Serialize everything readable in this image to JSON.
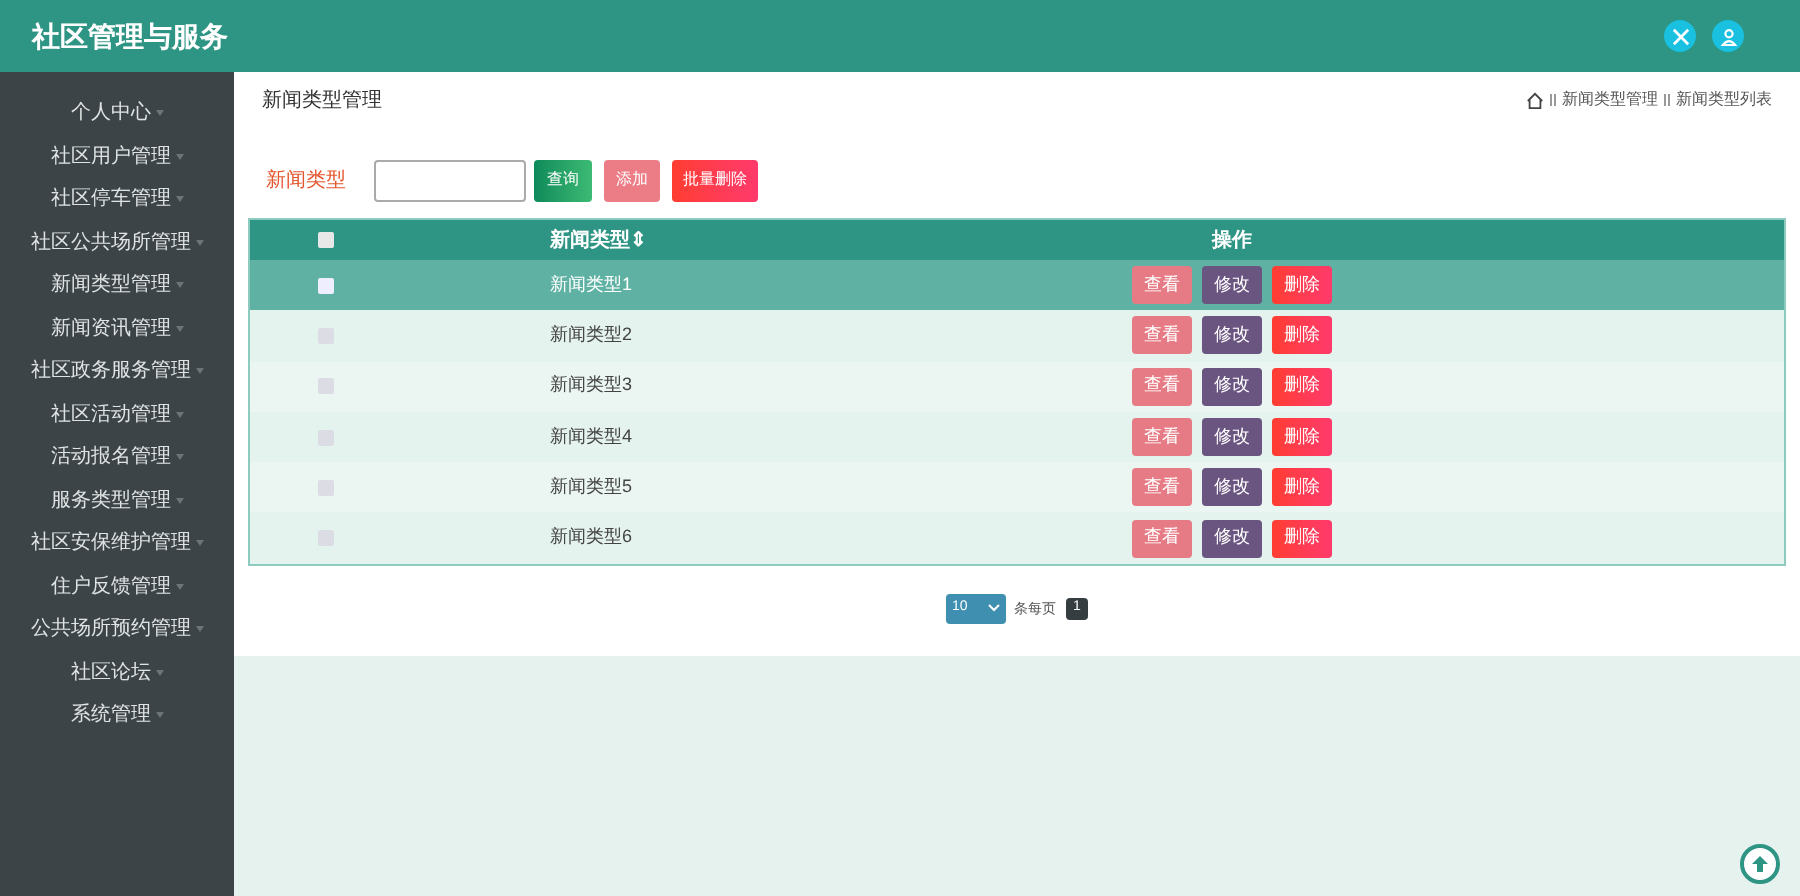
{
  "header": {
    "title": "社区管理与服务"
  },
  "sidebar": {
    "items": [
      {
        "label": "个人中心"
      },
      {
        "label": "社区用户管理"
      },
      {
        "label": "社区停车管理"
      },
      {
        "label": "社区公共场所管理"
      },
      {
        "label": "新闻类型管理"
      },
      {
        "label": "新闻资讯管理"
      },
      {
        "label": "社区政务服务管理"
      },
      {
        "label": "社区活动管理"
      },
      {
        "label": "活动报名管理"
      },
      {
        "label": "服务类型管理"
      },
      {
        "label": "社区安保维护管理"
      },
      {
        "label": "住户反馈管理"
      },
      {
        "label": "公共场所预约管理"
      },
      {
        "label": "社区论坛"
      },
      {
        "label": "系统管理"
      }
    ]
  },
  "page_title": "新闻类型管理",
  "breadcrumb": [
    "新闻类型管理",
    "新闻类型列表"
  ],
  "search": {
    "label": "新闻类型",
    "buttons": [
      {
        "label": "查询",
        "kind": "query"
      },
      {
        "label": "添加",
        "kind": "add"
      },
      {
        "label": "批量删除",
        "kind": "batch-delete"
      }
    ]
  },
  "table": {
    "columns": [
      "新闻类型⇕",
      "操作"
    ],
    "header_checked": false,
    "rows": [
      {
        "name": "新闻类型1",
        "selected": true,
        "checked": false,
        "actions": [
          "查看",
          "修改",
          "删除"
        ]
      },
      {
        "name": "新闻类型2",
        "selected": false,
        "checked": false,
        "actions": [
          "查看",
          "修改",
          "删除"
        ]
      },
      {
        "name": "新闻类型3",
        "selected": false,
        "checked": false,
        "actions": [
          "查看",
          "修改",
          "删除"
        ]
      },
      {
        "name": "新闻类型4",
        "selected": false,
        "checked": false,
        "actions": [
          "查看",
          "修改",
          "删除"
        ]
      },
      {
        "name": "新闻类型5",
        "selected": false,
        "checked": false,
        "actions": [
          "查看",
          "修改",
          "删除"
        ]
      },
      {
        "name": "新闻类型6",
        "selected": false,
        "checked": false,
        "actions": [
          "查看",
          "修改",
          "删除"
        ]
      }
    ]
  },
  "pagination": {
    "page_size": "10",
    "page_size_label": "条每页",
    "pages": [
      {
        "label": "1",
        "selected": true
      }
    ]
  }
}
